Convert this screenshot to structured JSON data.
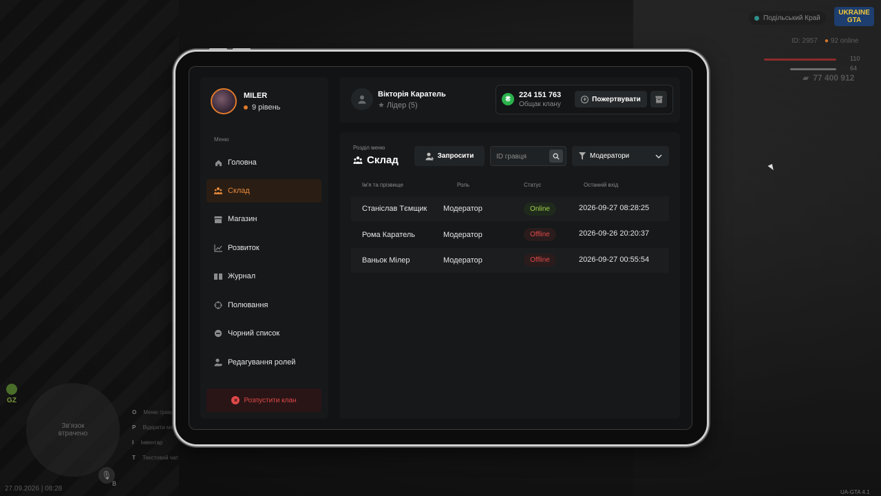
{
  "hud": {
    "server": "Подільський Край",
    "logo_top": "UKRAINE",
    "logo_bottom": "GTA",
    "player_id": "ID: 2957",
    "online": "92 online",
    "health": "110",
    "armor": "64",
    "money": "77 400 912",
    "gz": "GZ",
    "map_text": "Зв'язок втрачено",
    "keys": [
      {
        "key": "O",
        "label": "Меню гравця"
      },
      {
        "key": "P",
        "label": "Відкрити меню"
      },
      {
        "key": "I",
        "label": "Інвентар"
      },
      {
        "key": "T",
        "label": "Текстовий чат"
      }
    ],
    "datetime": "27.09.2026 | 08:28",
    "mic_key": "B",
    "version": "UA-GTA 4.1"
  },
  "profile": {
    "name": "MILER",
    "level": "9 рівень"
  },
  "menu": {
    "title": "Меню",
    "items": [
      {
        "label": "Головна",
        "icon": "home-icon",
        "active": false
      },
      {
        "label": "Склад",
        "icon": "users-icon",
        "active": true
      },
      {
        "label": "Магазин",
        "icon": "shop-icon",
        "active": false
      },
      {
        "label": "Розвиток",
        "icon": "chart-icon",
        "active": false
      },
      {
        "label": "Журнал",
        "icon": "book-icon",
        "active": false
      },
      {
        "label": "Полювання",
        "icon": "crosshair-icon",
        "active": false
      },
      {
        "label": "Чорний список",
        "icon": "block-icon",
        "active": false
      },
      {
        "label": "Редагування ролей",
        "icon": "user-edit-icon",
        "active": false
      }
    ],
    "disband_label": "Розпустити клан"
  },
  "leader": {
    "name": "Вікторія Каратель",
    "role": "Лідер (5)"
  },
  "bank": {
    "amount": "224 151 763",
    "label": "Общак клану",
    "donate_label": "Пожертвувати"
  },
  "section": {
    "label": "Розділ меню",
    "title": "Склад",
    "invite_label": "Запросити",
    "search_placeholder": "ID гравця",
    "filter_value": "Модератори"
  },
  "table": {
    "headers": [
      "Ім'я та прізвище",
      "Роль",
      "Статус",
      "Останній вхід"
    ],
    "rows": [
      {
        "name": "Станіслав Тємщик",
        "role": "Модератор",
        "status": "Online",
        "last_login": "2026-09-27 08:28:25"
      },
      {
        "name": "Рома Каратель",
        "role": "Модератор",
        "status": "Offline",
        "last_login": "2026-09-26 20:20:37"
      },
      {
        "name": "Ваньок Мілер",
        "role": "Модератор",
        "status": "Offline",
        "last_login": "2026-09-27 00:55:54"
      }
    ]
  },
  "colors": {
    "accent": "#e8893a",
    "online": "#9fd04a",
    "offline": "#e04848",
    "coin": "#2bb24c"
  }
}
